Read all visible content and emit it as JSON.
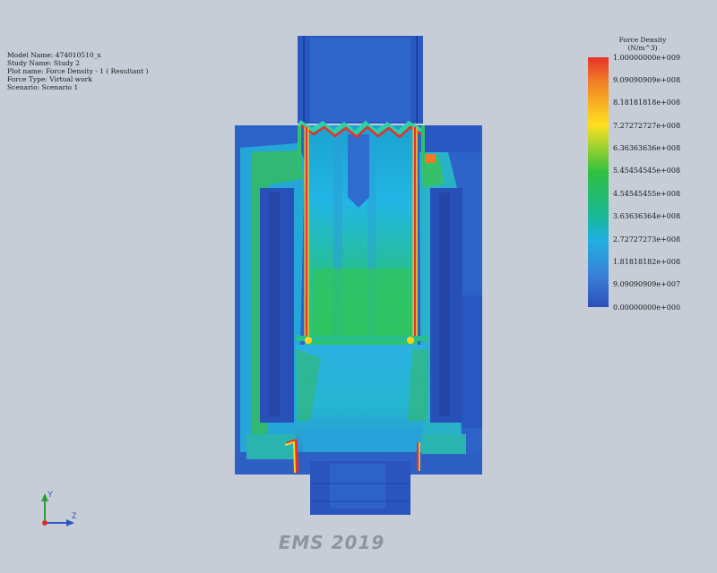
{
  "study_info": {
    "model_name": "Model Name: 474010510_x",
    "study_name": "Study Name: Study 2",
    "plot_name": "Plot name: Force Density  - 1 ( Resultant )",
    "force_type": "Force Type: Virtual work",
    "scenario": "Scenario: Scenario 1"
  },
  "legend": {
    "title": "Force Density",
    "unit": "(N/m^3)",
    "ticks": [
      "1.00000000e+009",
      "9.09090909e+008",
      "8.18181818e+008",
      "7.27272727e+008",
      "6.36363636e+008",
      "5.45454545e+008",
      "4.54545455e+008",
      "3.63636364e+008",
      "2.72727273e+008",
      "1.81818182e+008",
      "9.09090909e+007",
      "0.00000000e+000"
    ],
    "colors": [
      "#e8322a",
      "#f07a26",
      "#ffe020",
      "#30c040",
      "#19b89a",
      "#20b0e0",
      "#3a7ed8",
      "#2a50b8"
    ]
  },
  "triad": {
    "y_label": "Y",
    "z_label": "Z"
  },
  "watermark": "EMS 2019"
}
